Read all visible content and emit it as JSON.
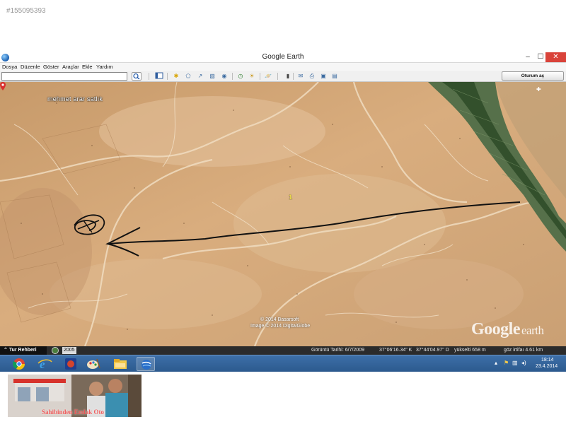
{
  "listing_id": "#155095393",
  "window": {
    "title": "Google Earth",
    "min_label": "–",
    "max_label": "☐",
    "close_label": "✕"
  },
  "menu": [
    "Dosya",
    "Düzenle",
    "Göster",
    "Araçlar",
    "Ekle",
    "Yardım"
  ],
  "toolbar": {
    "search_value": "",
    "signin_label": "Oturum aç"
  },
  "map": {
    "placemark_label": "mehmet arar satlık",
    "number_label": "1",
    "copyright_1": "© 2014 Basarsoft",
    "copyright_2": "Image © 2014 DigitalGlobe",
    "logo_google": "Google",
    "logo_earth": "earth"
  },
  "status": {
    "tour_label": "Tur Rehberi",
    "year": "2005",
    "imagery_date": "Görüntü Tarihi: 6/7/2009",
    "lat": "37°06'16.34\" K",
    "lon": "37°44'04.97\" D",
    "elevation": "yükselti 658 m",
    "eye_alt": "göz irtifaı 4.61 km"
  },
  "taskbar": {
    "apps": [
      "chrome-icon",
      "internet-explorer-icon",
      "media-icon",
      "paint-icon",
      "file-explorer-icon",
      "google-earth-icon"
    ],
    "time": "18:14",
    "date": "23.4.2014"
  },
  "banner": {
    "text": "Sahibinden Emlak Oto"
  },
  "colors": {
    "terrain": "#d2a575",
    "river": "#3f5a35",
    "taskbar": "#2f5f94",
    "close": "#d9433a"
  }
}
